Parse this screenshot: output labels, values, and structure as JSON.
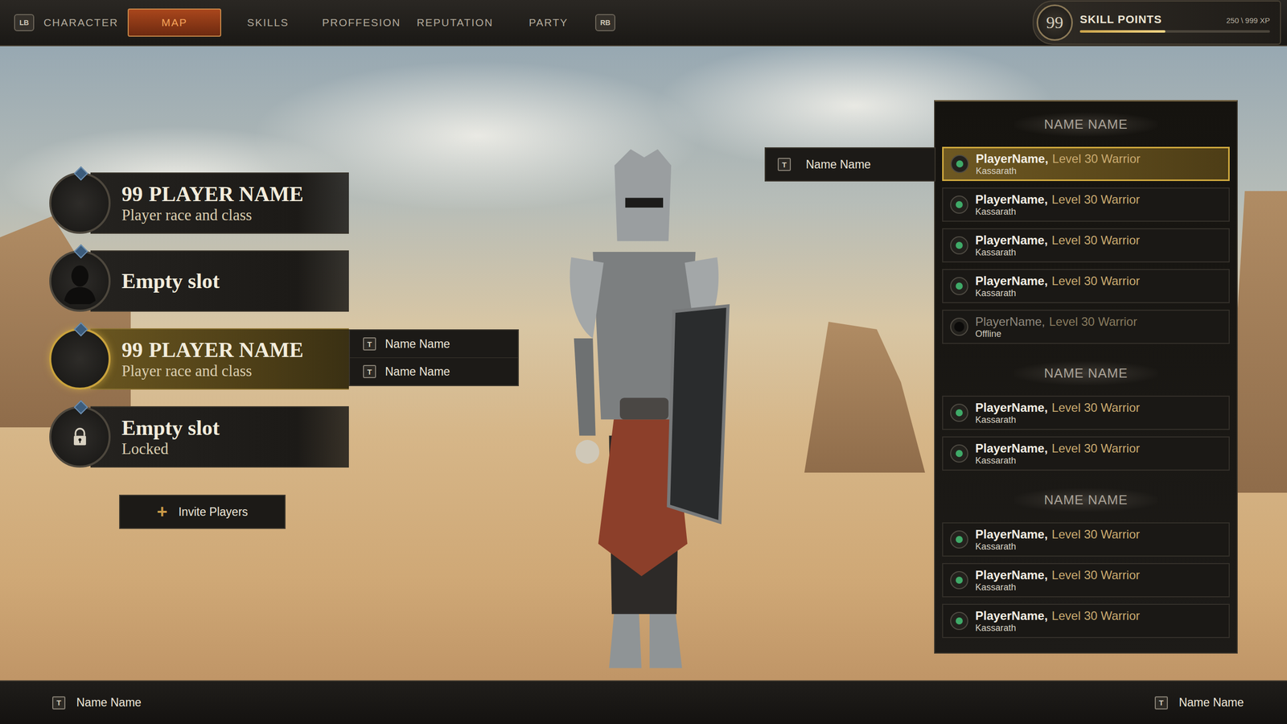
{
  "top_bar": {
    "left_key": "LB",
    "right_key": "RB",
    "tabs": [
      {
        "label": "CHARACTER",
        "selected": false
      },
      {
        "label": "MAP",
        "selected": true
      },
      {
        "label": "SKILLS",
        "selected": false
      },
      {
        "label": "PROFFESION",
        "selected": false
      },
      {
        "label": "REPUTATION",
        "selected": false
      },
      {
        "label": "PARTY",
        "selected": false
      }
    ]
  },
  "skill_points": {
    "value": "99",
    "label": "SKILL POINTS",
    "xp": "250 \\ 999 XP",
    "level": 0.45
  },
  "party_slots": [
    {
      "kind": "player",
      "rank": "99",
      "title": "PLAYER NAME",
      "subtitle": "Player race and class",
      "selected": false
    },
    {
      "kind": "empty",
      "rank": "",
      "title": "Empty slot",
      "subtitle": "",
      "selected": false
    },
    {
      "kind": "player",
      "rank": "99",
      "title": "PLAYER NAME",
      "subtitle": "Player race and class",
      "selected": true
    },
    {
      "kind": "locked",
      "rank": "",
      "title": "Empty slot",
      "subtitle": "Locked",
      "selected": false
    }
  ],
  "slot_menu": {
    "items": [
      {
        "key": "T",
        "label": "Name Name"
      },
      {
        "key": "T",
        "label": "Name Name"
      }
    ]
  },
  "invite_button": {
    "icon": "+",
    "label": "Invite Players"
  },
  "player_menu": {
    "key": "T",
    "label": "Name Name"
  },
  "friends_panel": {
    "groups": [
      {
        "title": "NAME NAME",
        "players": [
          {
            "name": "PlayerName,",
            "info": "Level 30 Warrior",
            "location": "Kassarath",
            "online": true,
            "selected": true
          },
          {
            "name": "PlayerName,",
            "info": "Level 30 Warrior",
            "location": "Kassarath",
            "online": true,
            "selected": false
          },
          {
            "name": "PlayerName,",
            "info": "Level 30 Warrior",
            "location": "Kassarath",
            "online": true,
            "selected": false
          },
          {
            "name": "PlayerName,",
            "info": "Level 30 Warrior",
            "location": "Kassarath",
            "online": true,
            "selected": false
          },
          {
            "name": "PlayerName,",
            "info": "Level 30 Warrior",
            "location": "Offline",
            "online": false,
            "selected": false
          }
        ]
      },
      {
        "title": "NAME NAME",
        "players": [
          {
            "name": "PlayerName,",
            "info": "Level 30 Warrior",
            "location": "Kassarath",
            "online": true,
            "selected": false
          },
          {
            "name": "PlayerName,",
            "info": "Level 30 Warrior",
            "location": "Kassarath",
            "online": true,
            "selected": false
          }
        ]
      },
      {
        "title": "NAME NAME",
        "players": [
          {
            "name": "PlayerName,",
            "info": "Level 30 Warrior",
            "location": "Kassarath",
            "online": true,
            "selected": false
          },
          {
            "name": "PlayerName,",
            "info": "Level 30 Warrior",
            "location": "Kassarath",
            "online": true,
            "selected": false
          },
          {
            "name": "PlayerName,",
            "info": "Level 30 Warrior",
            "location": "Kassarath",
            "online": true,
            "selected": false
          }
        ]
      }
    ]
  },
  "bottom_bar": {
    "left": {
      "key": "T",
      "label": "Name Name"
    },
    "right": {
      "key": "T",
      "label": "Name Name"
    }
  }
}
